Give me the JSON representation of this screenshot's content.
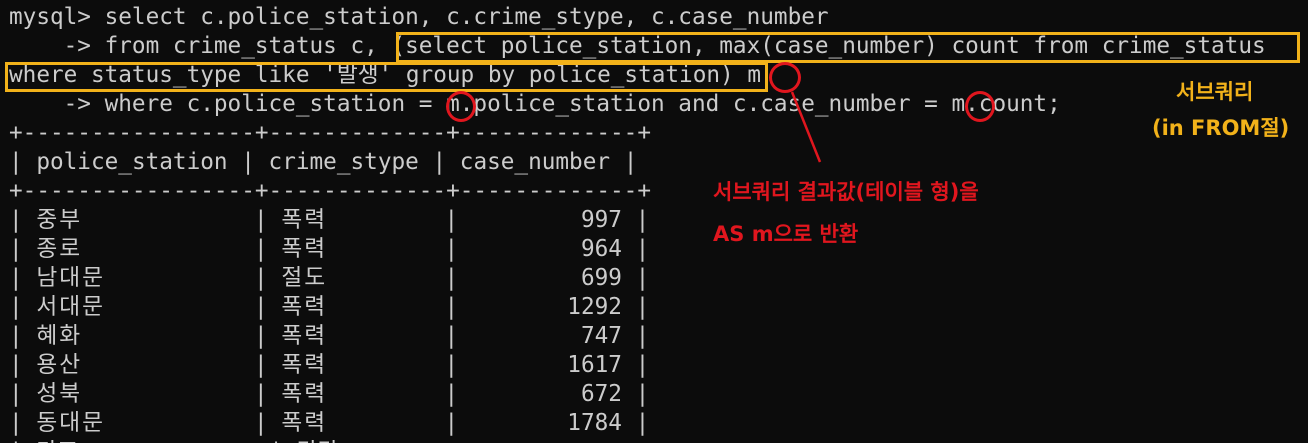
{
  "query": {
    "line1": "mysql> select c.police_station, c.crime_stype, c.case_number",
    "line2_pre": "    -> from crime_status c, ",
    "line2_sub": "(select police_station, max(case_number) count from crime_status",
    "line3_sub": "where status_type like '발생' group by police_station)",
    "line3_alias": " m",
    "line4": "    -> where c.police_station = m.police_station and c.case_number = m.count;"
  },
  "table": {
    "border": "+-----------------+-------------+-------------+",
    "headers": [
      "police_station",
      "crime_stype",
      "case_number"
    ],
    "rows": [
      {
        "station": "중부",
        "crime": "폭력",
        "num": "997"
      },
      {
        "station": "종로",
        "crime": "폭력",
        "num": "964"
      },
      {
        "station": "남대문",
        "crime": "절도",
        "num": "699"
      },
      {
        "station": "서대문",
        "crime": "폭력",
        "num": "1292"
      },
      {
        "station": "혜화",
        "crime": "폭력",
        "num": "747"
      },
      {
        "station": "용산",
        "crime": "폭력",
        "num": "1617"
      },
      {
        "station": "성북",
        "crime": "폭력",
        "num": "672"
      },
      {
        "station": "동대문",
        "crime": "폭력",
        "num": "1784"
      }
    ],
    "partial_row": "| 마포              | 강간"
  },
  "annotations": {
    "subquery_title": "서브쿼리",
    "subquery_subtitle": "(in FROM절)",
    "result_line1": "서브쿼리 결과값(테이블 형)을",
    "result_line2": "AS m으로 반환"
  },
  "colors": {
    "background": "#0c0c0c",
    "text": "#cccccc",
    "highlight_box": "#f2b21a",
    "circle": "#e0161e"
  }
}
